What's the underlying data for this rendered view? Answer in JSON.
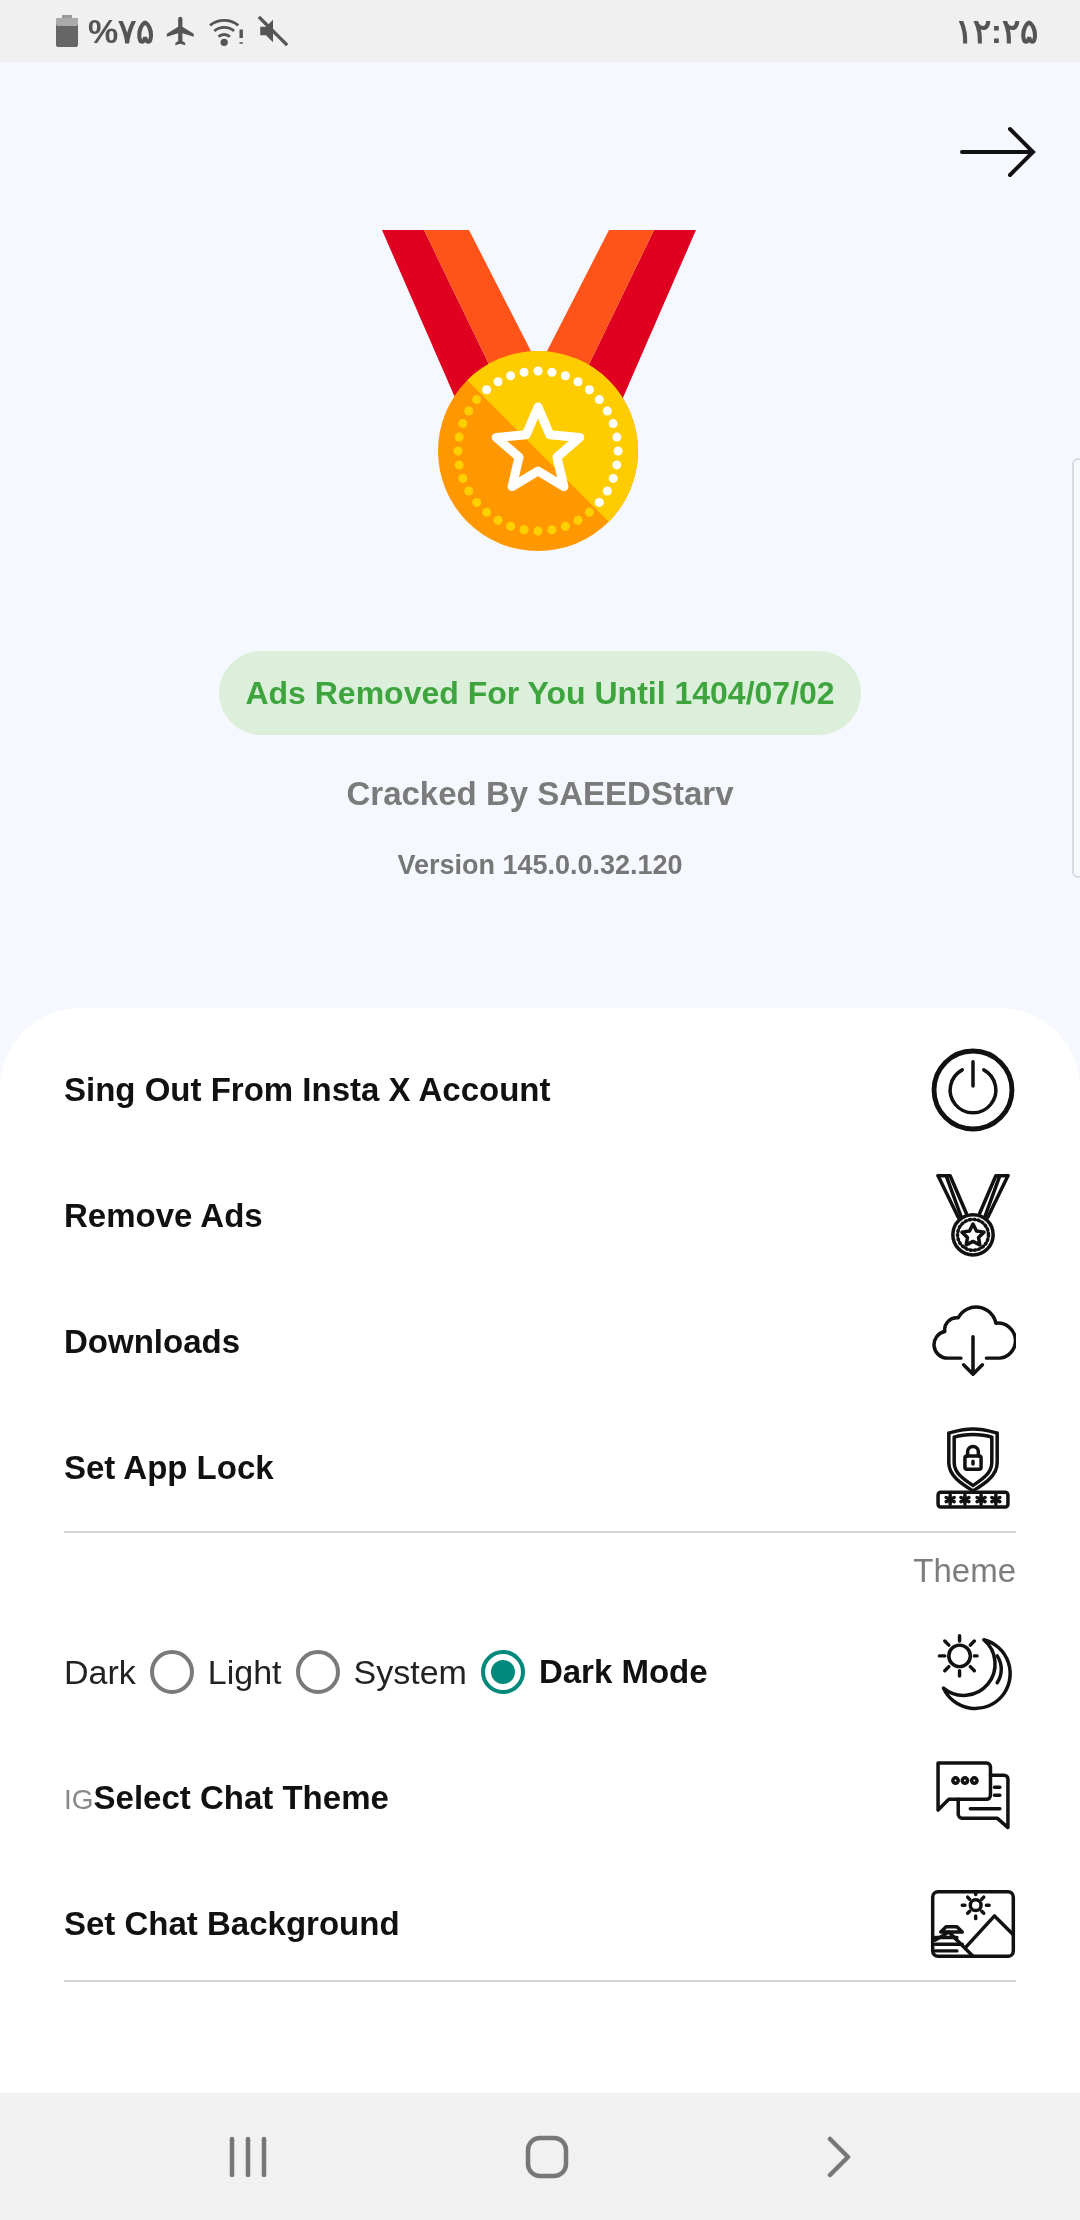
{
  "status_bar": {
    "battery": "%۷۵",
    "time": "۱۲:۲۵"
  },
  "header": {
    "ads_badge": "Ads Removed For You Until 1404/07/02",
    "credit": "Cracked By SAEEDStarv",
    "version": "Version 145.0.0.32.120"
  },
  "menu": [
    {
      "kind": "power",
      "label": "Sing Out From Insta X Account"
    },
    {
      "kind": "medal",
      "label": "Remove Ads"
    },
    {
      "kind": "download",
      "label": "Downloads"
    },
    {
      "kind": "lock",
      "label": "Set App Lock"
    }
  ],
  "theme_section": {
    "title": "Theme",
    "label": "Dark Mode",
    "options": [
      {
        "label": "Dark",
        "selected": false
      },
      {
        "label": "Light",
        "selected": false
      },
      {
        "label": "System",
        "selected": true
      }
    ]
  },
  "chat_items": [
    {
      "kind": "chat",
      "prefix": "IG",
      "label": "Select Chat Theme"
    },
    {
      "kind": "background",
      "label": "Set Chat Background"
    }
  ]
}
